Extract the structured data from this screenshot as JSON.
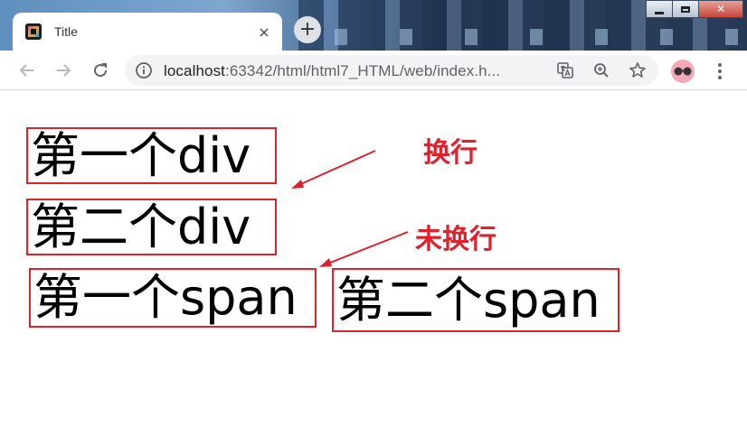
{
  "browser": {
    "tab_title": "Title",
    "tab_close_glyph": "×",
    "new_tab_glyph": "+",
    "url_host": "localhost",
    "url_path": ":63342/html/html7_HTML/web/index.h...",
    "window_controls": [
      "minimize",
      "maximize",
      "close"
    ],
    "close_glyph": "✕"
  },
  "page": {
    "div1": "第一个div",
    "div2": "第二个div",
    "span1": "第一个span",
    "span2": "第二个span",
    "annotation_wrap": "换行",
    "annotation_nowrap": "未换行"
  },
  "colors": {
    "annotation": "#e0202a",
    "tab_bg": "#ffffff",
    "omnibox_bg": "#f1f3f4"
  },
  "icons": [
    "back-arrow-icon",
    "forward-arrow-icon",
    "reload-icon",
    "info-icon",
    "translate-icon",
    "zoom-icon",
    "star-icon",
    "profile-avatar",
    "menu-dots-icon"
  ]
}
